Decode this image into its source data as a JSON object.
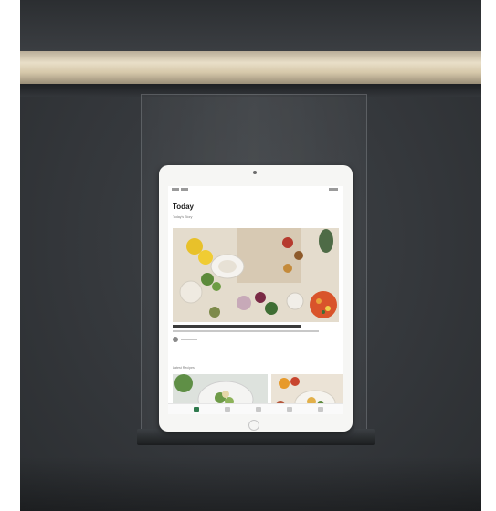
{
  "scene": {
    "description_tag": "ipad-on-kitchen-cabinet-stand",
    "led_color": "#e6dcc4",
    "cabinet_color": "#33363a"
  },
  "tablet_screen": {
    "title": "Today",
    "section_featured": "Today's Story",
    "section_recipes": "Latest Recipes",
    "tabs": [
      {
        "icon": "home-icon",
        "active": true
      },
      {
        "icon": "search-icon",
        "active": false
      },
      {
        "icon": "bookmark-icon",
        "active": false
      },
      {
        "icon": "cart-icon",
        "active": false
      },
      {
        "icon": "profile-icon",
        "active": false
      }
    ],
    "accent_color": "#2f7a4d"
  }
}
